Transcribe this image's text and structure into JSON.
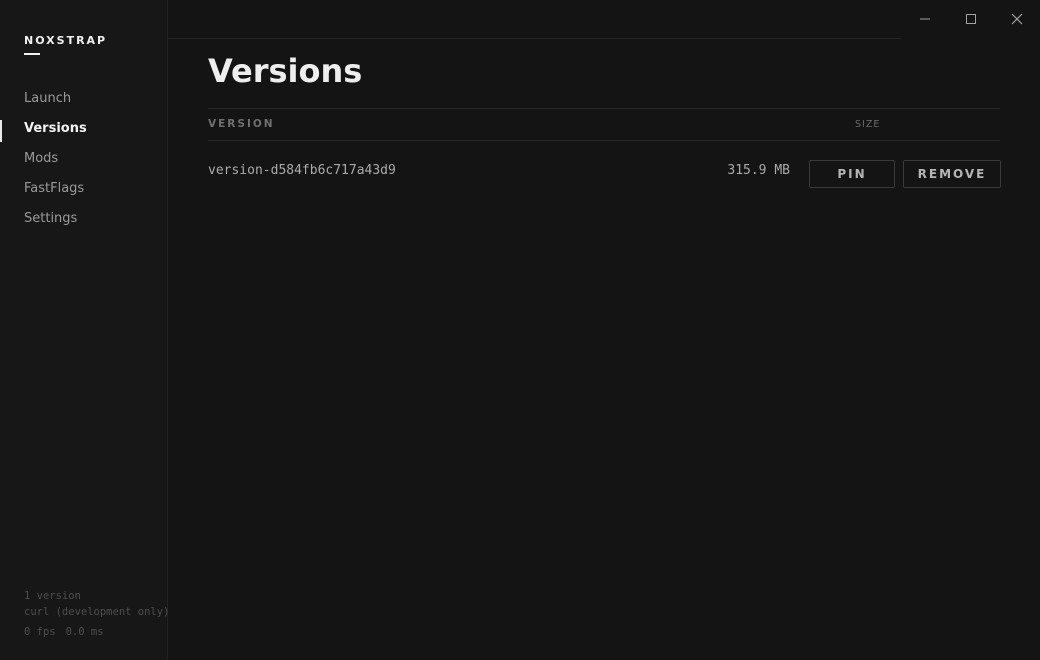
{
  "app": {
    "brand": "NOXSTRAP"
  },
  "sidebar": {
    "items": [
      {
        "label": "Launch",
        "active": false
      },
      {
        "label": "Versions",
        "active": true
      },
      {
        "label": "Mods",
        "active": false
      },
      {
        "label": "FastFlags",
        "active": false
      },
      {
        "label": "Settings",
        "active": false
      }
    ],
    "footer": {
      "version_count": "1 version",
      "backend": "curl (development only)",
      "fps": "0 fps",
      "frame_time": "0.0 ms"
    }
  },
  "window_controls": {
    "icons": [
      "minimize-icon",
      "maximize-icon",
      "close-icon"
    ]
  },
  "main": {
    "title": "Versions",
    "table": {
      "columns": {
        "version": "VERSION",
        "size": "SIZE"
      },
      "rows": [
        {
          "version": "version-d584fb6c717a43d9",
          "size": "315.9 MB",
          "pin_label": "PIN",
          "remove_label": "REMOVE"
        }
      ]
    }
  },
  "colors": {
    "background": "#141414",
    "sidebar": "#171717",
    "text_active": "#f2f2f2",
    "text_muted": "#9a9a9a"
  }
}
